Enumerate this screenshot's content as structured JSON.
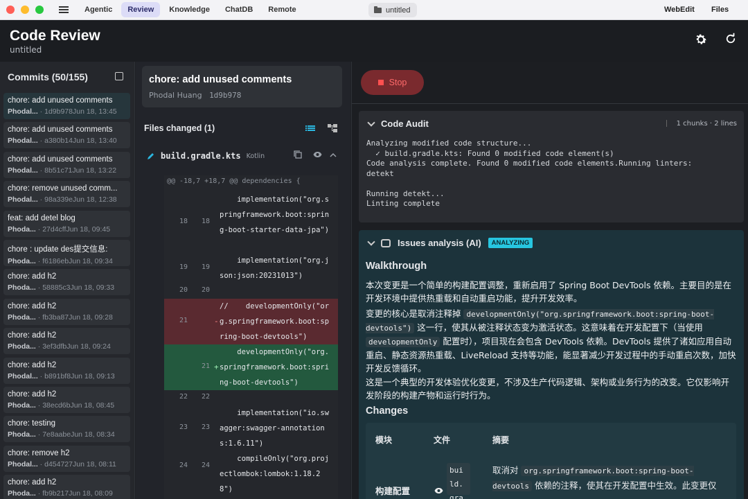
{
  "titlebar": {
    "tabs": [
      "Agentic",
      "Review",
      "Knowledge",
      "ChatDB",
      "Remote"
    ],
    "active_tab": "Review",
    "file_chip": "untitled",
    "right_links": [
      "WebEdit",
      "Files"
    ]
  },
  "header": {
    "title": "Code Review",
    "subtitle": "untitled",
    "icons": [
      "gear-icon",
      "refresh-icon"
    ]
  },
  "commits": {
    "heading": "Commits (50/155)",
    "items": [
      {
        "message": "chore: add unused comments",
        "author": "Phodal...",
        "meta": "1d9b978Jun 18, 13:45",
        "selected": true
      },
      {
        "message": "chore: add unused comments",
        "author": "Phodal...",
        "meta": "a380b14Jun 18, 13:40"
      },
      {
        "message": "chore: add unused comments",
        "author": "Phodal...",
        "meta": "8b51c71Jun 18, 13:22"
      },
      {
        "message": "chore: remove unused comm...",
        "author": "Phodal...",
        "meta": "98a339eJun 18, 12:38"
      },
      {
        "message": "feat: add detel blog",
        "author": "Phoda...",
        "meta": "27d4cffJun 18, 09:45"
      },
      {
        "message": "chore : update des提交信息:",
        "author": "Phoda...",
        "meta": "f6186ebJun 18, 09:34"
      },
      {
        "message": "chore: add h2",
        "author": "Phoda...",
        "meta": "58885c3Jun 18, 09:33"
      },
      {
        "message": "chore: add h2",
        "author": "Phoda...",
        "meta": "fb3ba87Jun 18, 09:28"
      },
      {
        "message": "chore: add h2",
        "author": "Phoda...",
        "meta": "3ef3dfbJun 18, 09:24"
      },
      {
        "message": "chore: add h2",
        "author": "Phodal...",
        "meta": "b891bf8Jun 18, 09:13"
      },
      {
        "message": "chore: add h2",
        "author": "Phoda...",
        "meta": "38ecd6bJun 18, 08:45"
      },
      {
        "message": "chore: testing",
        "author": "Phoda...",
        "meta": "7e8aabeJun 18, 08:34"
      },
      {
        "message": "chore: remove h2",
        "author": "Phodal...",
        "meta": "d454727Jun 18, 08:11"
      },
      {
        "message": "chore: add h2",
        "author": "Phoda...",
        "meta": "fb9b217Jun 18, 08:09"
      }
    ]
  },
  "commit_detail": {
    "title": "chore: add unused comments",
    "author": "Phodal Huang",
    "hash": "1d9b978"
  },
  "files": {
    "heading": "Files changed (1)",
    "file_name": "build.gradle.kts",
    "language": "Kotlin",
    "hunk": "@@ -18,7 +18,7 @@ dependencies {",
    "lines": [
      {
        "old": "18",
        "new": "18",
        "sign": "",
        "type": "ctx",
        "code": "    implementation(\"org.springframework.boot:spring-boot-starter-data-jpa\")"
      },
      {
        "old": "19",
        "new": "19",
        "sign": "",
        "type": "ctx",
        "code": "    implementation(\"org.json:json:20231013\")"
      },
      {
        "old": "20",
        "new": "20",
        "sign": "",
        "type": "ctx",
        "code": ""
      },
      {
        "old": "21",
        "new": "",
        "sign": "-",
        "type": "del",
        "code": "//    developmentOnly(\"org.springframework.boot:spring-boot-devtools\")"
      },
      {
        "old": "",
        "new": "21",
        "sign": "+",
        "type": "add",
        "code": "    developmentOnly(\"org.springframework.boot:spring-boot-devtools\")"
      },
      {
        "old": "22",
        "new": "22",
        "sign": "",
        "type": "ctx",
        "code": ""
      },
      {
        "old": "23",
        "new": "23",
        "sign": "",
        "type": "ctx",
        "code": "    implementation(\"io.swagger:swagger-annotations:1.6.11\")"
      },
      {
        "old": "24",
        "new": "24",
        "sign": "",
        "type": "ctx",
        "code": "    compileOnly(\"org.projectlombok:lombok:1.18.28\")"
      }
    ]
  },
  "right": {
    "stop_label": "Stop",
    "audit": {
      "title": "Code Audit",
      "meta": "1 chunks · 2 lines",
      "log": [
        "Analyzing modified code structure...",
        "  ✓ build.gradle.kts: Found 0 modified code element(s)",
        "Code analysis complete. Found 0 modified code elements.Running linters:",
        "detekt",
        "",
        "Running detekt...",
        "Linting complete"
      ]
    },
    "issues": {
      "title": "Issues analysis (AI)",
      "badge": "ANALYZING",
      "walkthrough_heading": "Walkthrough",
      "p1": "本次变更是一个简单的构建配置调整，重新启用了 Spring Boot DevTools 依赖。主要目的是在开发环境中提供热重载和自动重启功能，提升开发效率。",
      "p2a": "变更的核心是取消注释掉 ",
      "p2code1": "developmentOnly(\"org.springframework.boot:spring-boot-devtools\")",
      "p2b": " 这一行，使其从被注释状态变为激活状态。这意味着在开发配置下（当使用 ",
      "p2code2": "developmentOnly",
      "p2c": " 配置时），项目现在会包含 DevTools 依赖。DevTools 提供了诸如应用自动重启、静态资源热重载、LiveReload 支持等功能，能显著减少开发过程中的手动重启次数，加快开发反馈循环。",
      "p3": "这是一个典型的开发体验优化变更，不涉及生产代码逻辑、架构或业务行为的改变。它仅影响开发阶段的构建产物和运行时行为。",
      "changes_heading": "Changes",
      "table_headers": [
        "模块",
        "文件",
        "摘要"
      ],
      "row_module": "构建配置",
      "row_file": "build.gra",
      "row_summary_a": "取消对 ",
      "row_summary_code": "org.springframework.boot:spring-boot-devtools",
      "row_summary_b": " 依赖的注释，使其在开发配置中生效。此变更仅"
    }
  }
}
